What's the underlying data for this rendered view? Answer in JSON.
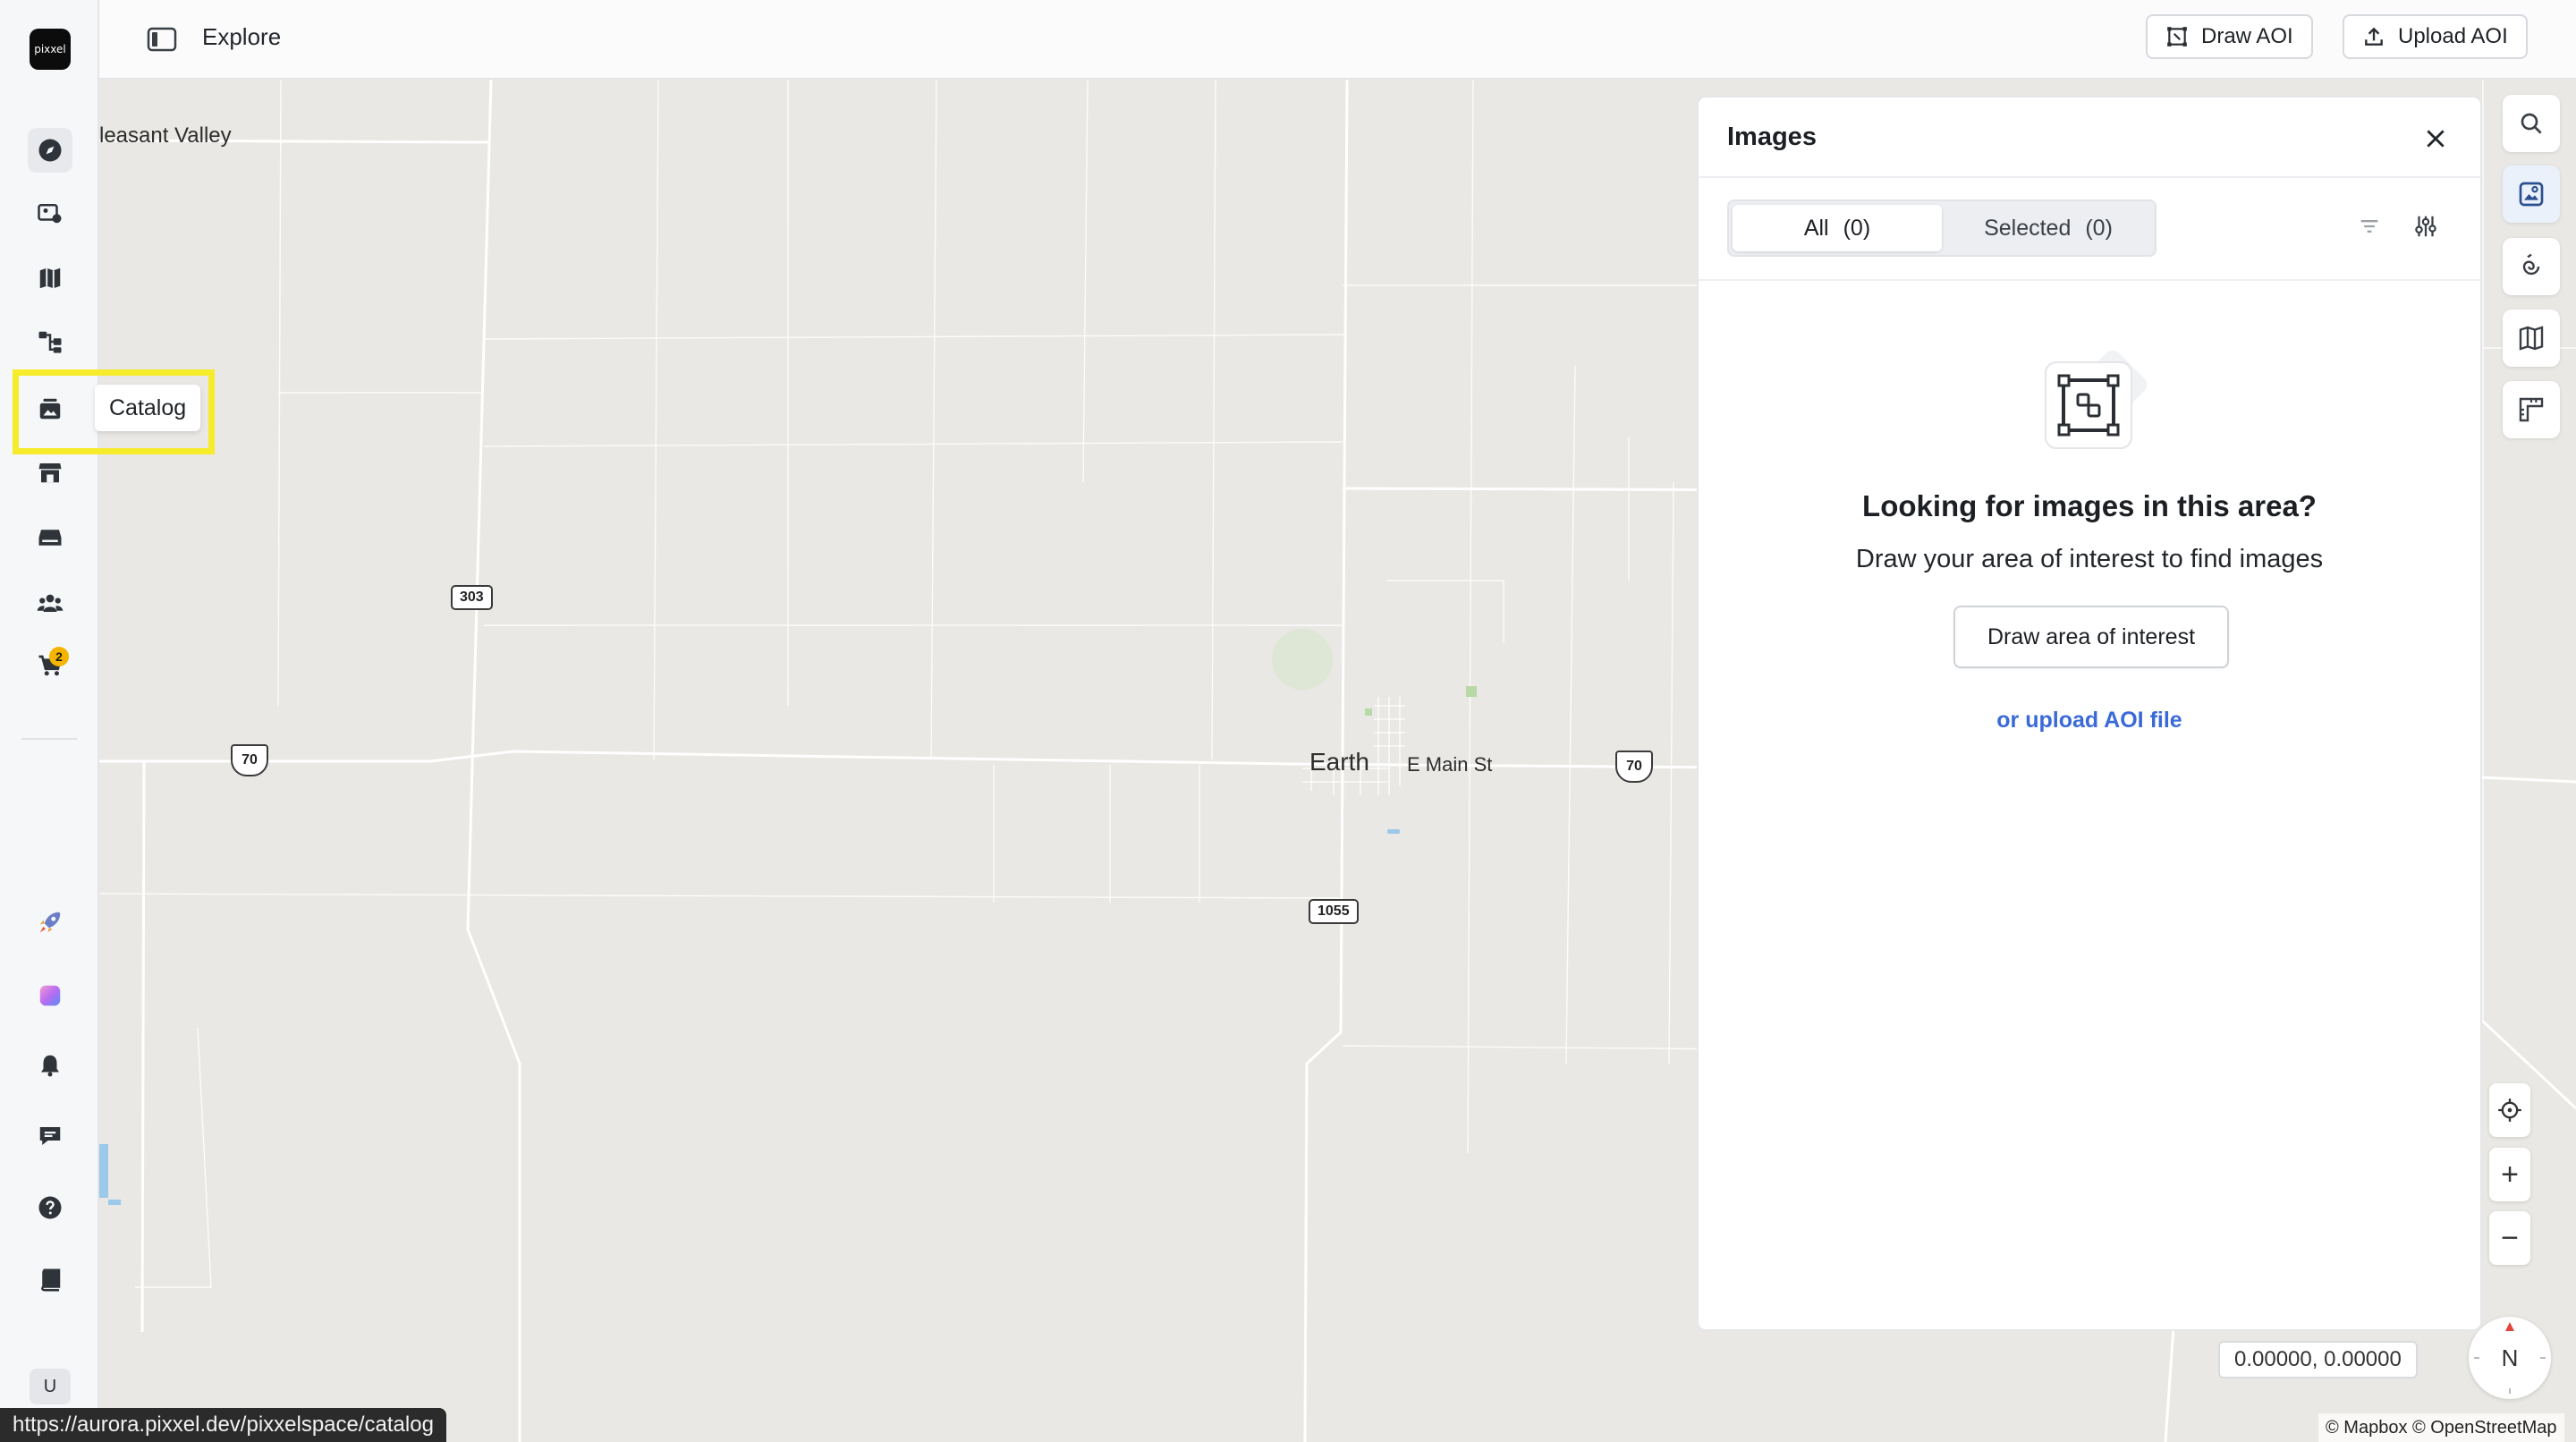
{
  "app": {
    "logo_text": "pixxel"
  },
  "header": {
    "title": "Explore",
    "draw_aoi_label": "Draw AOI",
    "upload_aoi_label": "Upload AOI"
  },
  "sidebar": {
    "items": [
      {
        "name": "explore",
        "icon": "compass-icon"
      },
      {
        "name": "tasking",
        "icon": "satellite-image-icon"
      },
      {
        "name": "maps",
        "icon": "map-icon"
      },
      {
        "name": "workflows",
        "icon": "workflow-icon"
      },
      {
        "name": "catalog",
        "icon": "catalog-icon",
        "tooltip": "Catalog"
      },
      {
        "name": "store",
        "icon": "store-icon"
      },
      {
        "name": "storage",
        "icon": "storage-icon"
      },
      {
        "name": "teams",
        "icon": "team-icon"
      },
      {
        "name": "cart",
        "icon": "cart-icon",
        "badge": "2"
      }
    ],
    "bottom_items": [
      {
        "name": "whats-new",
        "icon": "rocket-icon"
      },
      {
        "name": "apps",
        "icon": "gradient-app-icon"
      },
      {
        "name": "notifications",
        "icon": "bell-icon"
      },
      {
        "name": "feedback",
        "icon": "chat-icon"
      },
      {
        "name": "help",
        "icon": "help-icon"
      },
      {
        "name": "docs",
        "icon": "book-icon"
      }
    ],
    "avatar_initial": "U"
  },
  "map": {
    "labels": {
      "pleasant_valley": "leasant Valley",
      "earth": "Earth",
      "e_main_st": "E Main St"
    },
    "shields": {
      "us70_left": "70",
      "us70_right": "70",
      "sr303": "303",
      "fm1055": "1055"
    },
    "coordinates": "0.00000, 0.00000",
    "attribution": "© Mapbox © OpenStreetMap",
    "compass_label": "N",
    "zoom_in": "+",
    "zoom_out": "−"
  },
  "panel": {
    "title": "Images",
    "tabs": {
      "all_label": "All",
      "all_count": "(0)",
      "selected_label": "Selected",
      "selected_count": "(0)"
    },
    "empty_heading": "Looking for images in this area?",
    "empty_sub": "Draw your area of interest to find images",
    "draw_button": "Draw area of interest",
    "upload_link": "or upload AOI file"
  },
  "status_url": "https://aurora.pixxel.dev/pixxelspace/catalog",
  "colors": {
    "highlight": "#f6ec2b",
    "link": "#3a6ad8",
    "badge": "#f5b400"
  }
}
